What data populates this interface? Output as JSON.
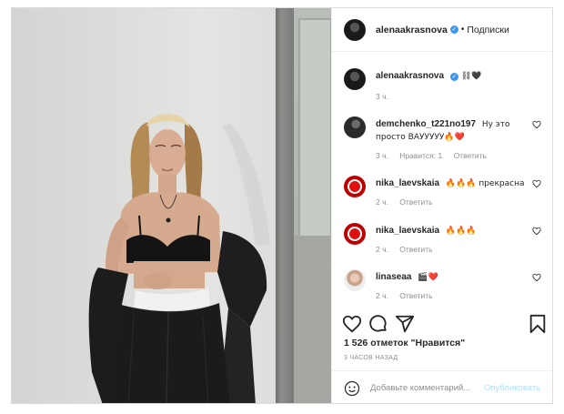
{
  "post": {
    "author": "alenaakrasnova",
    "follow_label": "Подписки",
    "separator": "•",
    "caption_emoji": "⛓🖤",
    "caption_time": "3 ч.",
    "likes": "1 526 отметок \"Нравится\"",
    "posted_ago": "3 ЧАСОВ НАЗАД"
  },
  "comments": [
    {
      "user": "demchenko_t221no197",
      "text": "Ну это просто ВАУУУУУ🔥❤️",
      "time": "3 ч.",
      "likes": "Нравится: 1",
      "reply": "Ответить"
    },
    {
      "user": "nika_laevskaia",
      "text": "🔥🔥🔥 прекрасна",
      "time": "2 ч.",
      "reply": "Ответить"
    },
    {
      "user": "nika_laevskaia",
      "text": "🔥🔥🔥",
      "time": "2 ч.",
      "reply": "Ответить"
    },
    {
      "user": "linaseaa",
      "text": "🎬❤️",
      "time": "2 ч.",
      "reply": "Ответить"
    }
  ],
  "add_comment": {
    "placeholder": "Добавьте комментарий...",
    "publish_label": "Опубликовать"
  },
  "icons": [
    "verified-icon",
    "heart-icon",
    "comment-icon",
    "share-icon",
    "bookmark-icon",
    "emoji-icon"
  ],
  "colors": {
    "verified": "#3897f0",
    "publish_disabled": "#b2dffc",
    "muted": "#8e8e8e"
  }
}
